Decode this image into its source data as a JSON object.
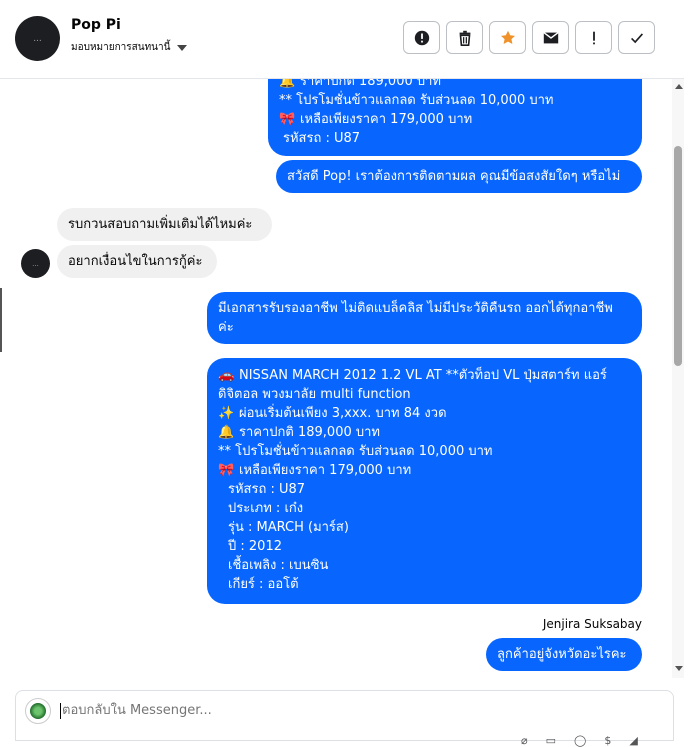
{
  "header": {
    "name": "Pop Pi",
    "assign_label": "มอบหมายการสนทนานี้",
    "avatar_text": "..."
  },
  "messages": {
    "top_partial": [
      {
        "emoji": "🔔",
        "text": "ราคาปกติ 189,000 บาท"
      },
      {
        "emoji": "",
        "text": "** โปรโมชั่นข้าวแลกลด รับส่วนลด 10,000 บาท"
      },
      {
        "emoji": "🎀",
        "text": "เหลือเพียงราคา 179,000 บาท"
      },
      {
        "emoji": "",
        "text": "รหัสรถ : U87"
      }
    ],
    "greeting": "สวัสดี Pop! เราต้องการติดตามผล คุณมีข้อสงสัยใดๆ หรือไม่",
    "in1": "รบกวนสอบถามเพิ่มเติมได้ไหมค่ะ",
    "in2": "อยากเงื่อนไขในการกู้ค่ะ",
    "docs_l1": "มีเอกสารรับรองอาชีพ ไม่ติดแบล็คลิส ไม่มีประวัติคืนรถ ออกได้ทุกอาชีพ",
    "docs_l2": "ค่ะ",
    "car": [
      {
        "emoji": "🚗",
        "text": "NISSAN MARCH 2012 1.2 VL AT **ตัวท็อป VL ปุ่มสตาร์ท แอร์"
      },
      {
        "emoji": "",
        "text": "ดิจิตอล พวงมาลัย multi function"
      },
      {
        "emoji": "✨",
        "text": "ผ่อนเริ่มต้นเพียง 3,xxx. บาท 84 งวด"
      },
      {
        "emoji": "🔔",
        "text": "ราคาปกติ 189,000 บาท"
      },
      {
        "emoji": "",
        "text": "** โปรโมชั่นข้าวแลกลด รับส่วนลด 10,000 บาท"
      },
      {
        "emoji": "🎀",
        "text": "เหลือเพียงราคา 179,000 บาท"
      },
      {
        "emoji": "",
        "text": "รหัสรถ : U87"
      },
      {
        "emoji": "",
        "text": "ประเภท : เก๋ง"
      },
      {
        "emoji": "",
        "text": "รุ่น : MARCH (มาร์ส)"
      },
      {
        "emoji": "",
        "text": "ปี : 2012"
      },
      {
        "emoji": "",
        "text": "เชื้อเพลิง : เบนซิน"
      },
      {
        "emoji": "",
        "text": "เกียร์ : ออโต้"
      }
    ],
    "sender": "Jenjira Suksabay",
    "last": "ลูกค้าอยู่จังหวัดอะไรคะ"
  },
  "composer": {
    "placeholder": "ตอบกลับใน Messenger..."
  },
  "colors": {
    "outgoing": "#0866ff",
    "incoming": "#f0f0f0",
    "star": "#f0922a"
  }
}
